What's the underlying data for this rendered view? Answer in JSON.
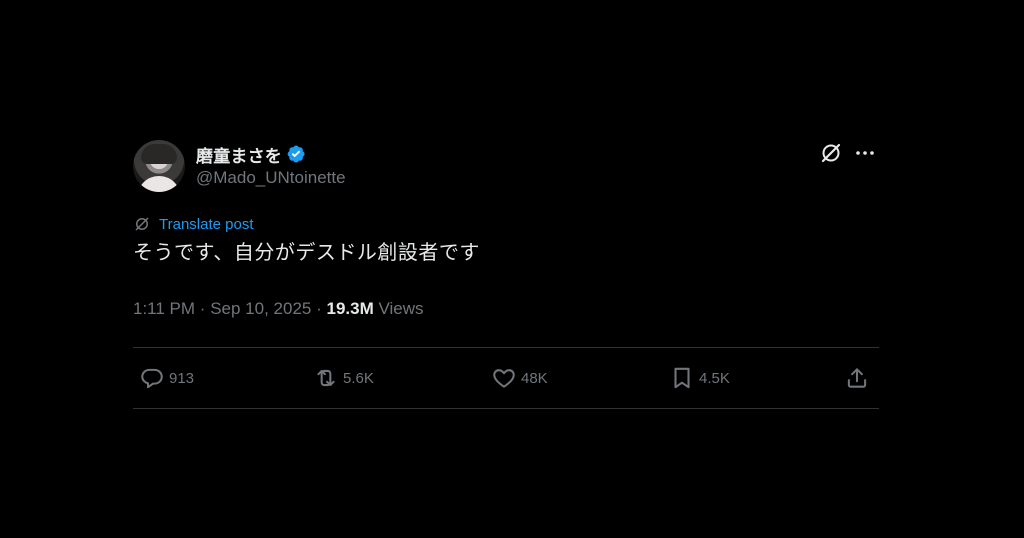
{
  "author": {
    "display_name": "磨童まさを",
    "handle": "@Mado_UNtoinette",
    "verified": true
  },
  "translate": {
    "label": "Translate post"
  },
  "tweet": {
    "text": "そうです、自分がデスドル創設者です"
  },
  "meta": {
    "time": "1:11 PM",
    "separator": "·",
    "date": "Sep 10, 2025",
    "views_count": "19.3M",
    "views_label": "Views"
  },
  "actions": {
    "replies": "913",
    "reposts": "5.6K",
    "likes": "48K",
    "bookmarks": "4.5K"
  },
  "icons": {
    "reply": "reply-icon",
    "repost": "repost-icon",
    "like": "heart-icon",
    "bookmark": "bookmark-icon",
    "share": "share-icon",
    "grok": "grok-icon",
    "more": "more-icon",
    "verified": "verified-badge-icon"
  },
  "colors": {
    "background": "#000000",
    "text": "#e7e9ea",
    "secondary": "#71767b",
    "accent": "#1d9bf0",
    "divider": "#2f3336"
  }
}
